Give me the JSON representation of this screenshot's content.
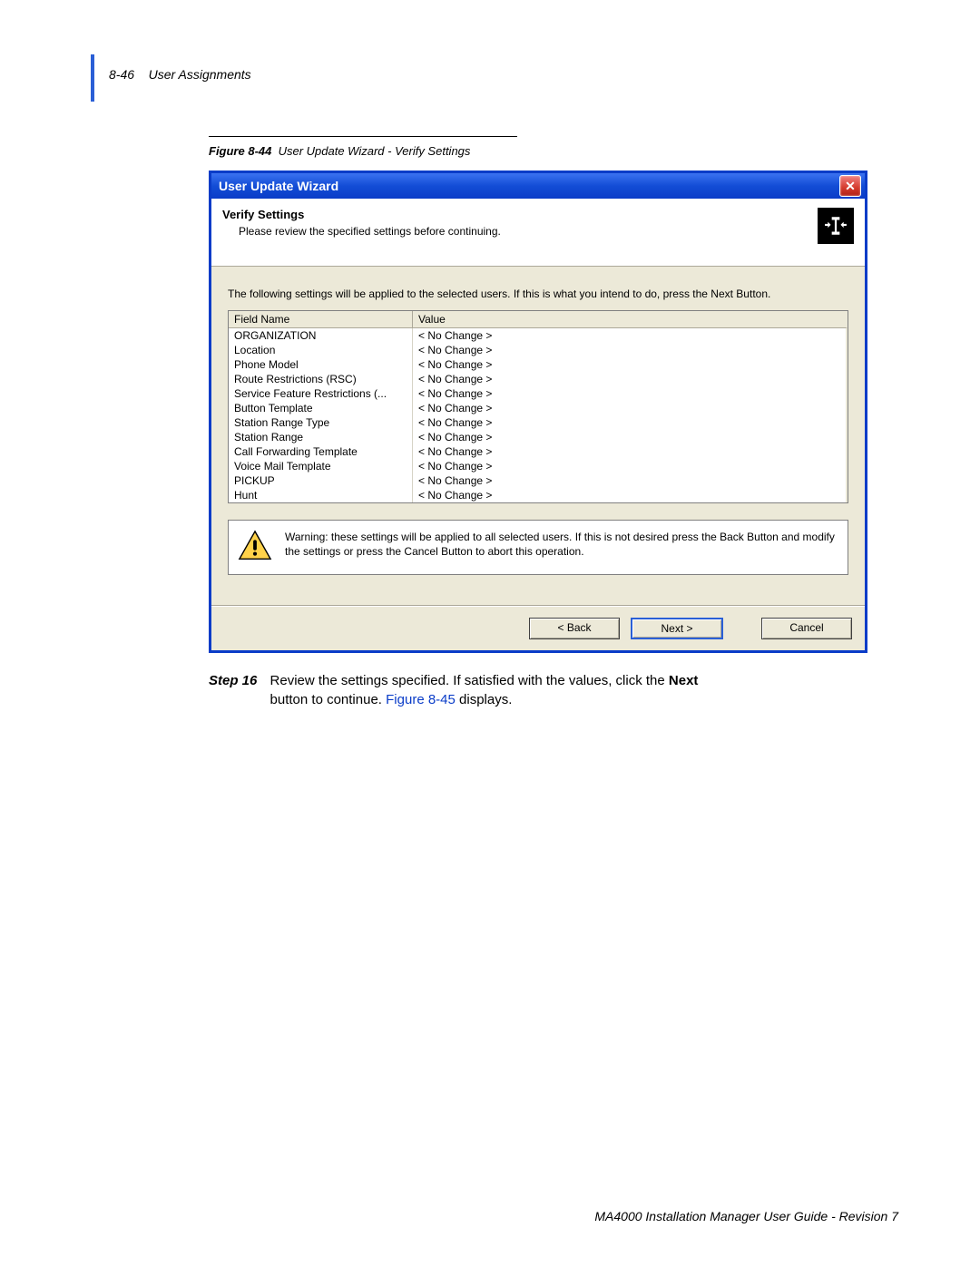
{
  "page_header": {
    "page_number": "8-46",
    "section": "User Assignments"
  },
  "figure": {
    "label": "Figure 8-44",
    "title": "User Update Wizard - Verify Settings"
  },
  "dialog": {
    "title": "User Update Wizard",
    "header": {
      "title": "Verify Settings",
      "subtitle": "Please review the specified settings before continuing."
    },
    "intro": "The following settings will be applied to the selected users. If this is what you intend to do, press the Next Button.",
    "columns": {
      "c1": "Field Name",
      "c2": "Value"
    },
    "rows": [
      {
        "field": "ORGANIZATION",
        "value": "< No Change >"
      },
      {
        "field": "Location",
        "value": "< No Change >"
      },
      {
        "field": "Phone Model",
        "value": "< No Change >"
      },
      {
        "field": "Route Restrictions (RSC)",
        "value": "< No Change >"
      },
      {
        "field": "Service Feature Restrictions (...",
        "value": "< No Change >"
      },
      {
        "field": "Button Template",
        "value": "< No Change >"
      },
      {
        "field": "Station Range Type",
        "value": "< No Change >"
      },
      {
        "field": "Station Range",
        "value": "< No Change >"
      },
      {
        "field": "Call Forwarding Template",
        "value": "< No Change >"
      },
      {
        "field": "Voice Mail Template",
        "value": "< No Change >"
      },
      {
        "field": "PICKUP",
        "value": "< No Change >"
      },
      {
        "field": "Hunt",
        "value": "< No Change >"
      }
    ],
    "warning": "Warning: these settings will be applied to all selected users. If this is not desired press the Back Button and modify the settings or press the Cancel Button to abort this operation.",
    "buttons": {
      "back": "< Back",
      "next": "Next >",
      "cancel": "Cancel"
    }
  },
  "step": {
    "label": "Step  16",
    "text_before": "Review the settings specified. If satisfied with the values, click the ",
    "next_word": "Next",
    "text_mid": " button to continue.  ",
    "figref": "Figure 8-45",
    "text_after": " displays."
  },
  "footer": "MA4000 Installation Manager User Guide - Revision 7"
}
